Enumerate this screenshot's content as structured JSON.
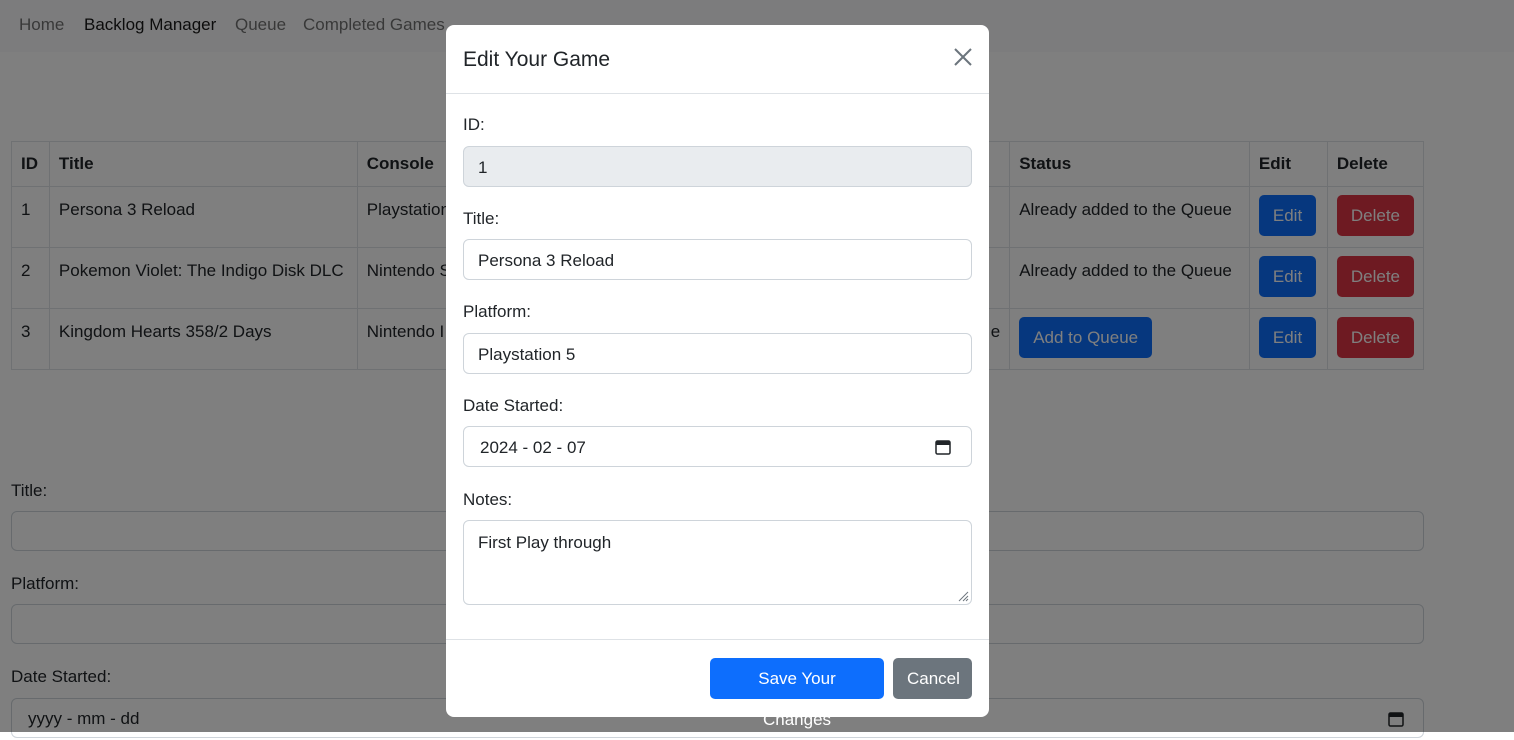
{
  "nav": {
    "items": [
      {
        "label": "Home",
        "active": false
      },
      {
        "label": "Backlog Manager",
        "active": true
      },
      {
        "label": "Queue",
        "active": false
      },
      {
        "label": "Completed Games",
        "active": false
      }
    ]
  },
  "table": {
    "headers": {
      "id": "ID",
      "title": "Title",
      "console": "Console",
      "status": "Status",
      "edit": "Edit",
      "delete": "Delete"
    },
    "rows": [
      {
        "id": "1",
        "title": "Persona 3 Reload",
        "console": "Playstation",
        "hidden_tail": "",
        "status": "Already added to the Queue",
        "status_button": null
      },
      {
        "id": "2",
        "title": "Pokemon Violet: The Indigo Disk DLC",
        "console": "Nintendo S",
        "hidden_tail": "",
        "status": "Already added to the Queue",
        "status_button": null
      },
      {
        "id": "3",
        "title": "Kingdom Hearts 358/2 Days",
        "console": "Nintendo I",
        "hidden_tail": "e",
        "status": "",
        "status_button": "Add to Queue"
      }
    ],
    "edit_label": "Edit",
    "delete_label": "Delete"
  },
  "add_form": {
    "title_label": "Title:",
    "platform_label": "Platform:",
    "date_label": "Date Started:",
    "date_placeholder": "yyyy - mm - dd"
  },
  "modal": {
    "title": "Edit Your Game",
    "id_label": "ID:",
    "id_value": "1",
    "title_label": "Title:",
    "title_value": "Persona 3 Reload",
    "platform_label": "Platform:",
    "platform_value": "Playstation 5",
    "date_label": "Date Started:",
    "date_value": "2024 - 02 - 07",
    "notes_label": "Notes:",
    "notes_value": "First Play through",
    "save_label": "Save Your Changes",
    "cancel_label": "Cancel"
  },
  "colors": {
    "primary": "#0d6efd",
    "danger": "#dc3545",
    "secondary": "#6c757d",
    "backdrop": "rgba(0,0,0,0.5)"
  }
}
